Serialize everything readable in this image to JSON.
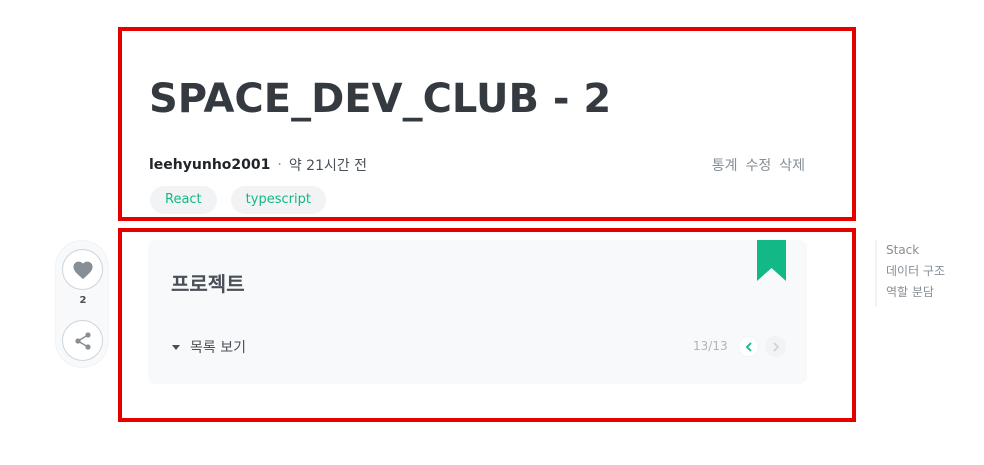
{
  "post": {
    "title": "SPACE_DEV_CLUB - 2",
    "author": "leehyunho2001",
    "separator": "·",
    "date": "약 21시간 전",
    "actions": [
      "통계",
      "수정",
      "삭제"
    ],
    "tags": [
      "React",
      "typescript"
    ]
  },
  "series": {
    "title": "프로젝트",
    "toggle_label": "목록 보기",
    "count": "13/13",
    "prev_icon": "chevron-left-icon",
    "next_icon": "chevron-right-icon"
  },
  "sidebar": {
    "like_count": "2",
    "like_icon": "heart-icon",
    "share_icon": "share-icon"
  },
  "toc": [
    "Stack",
    "데이터 구조",
    "역할 분담"
  ],
  "colors": {
    "accent": "#12b886",
    "annotation": "#e50000",
    "title": "#343a40"
  }
}
